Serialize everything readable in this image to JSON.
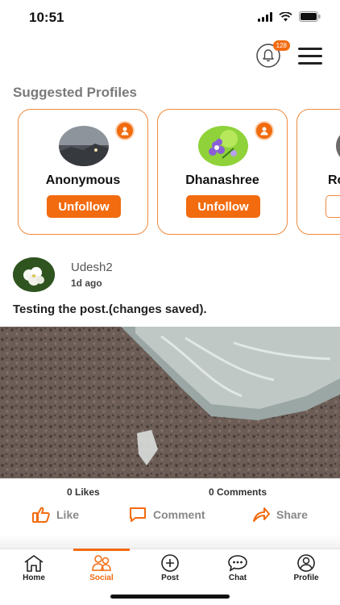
{
  "status_bar": {
    "time": "10:51"
  },
  "notifications": {
    "count": "128",
    "icon": "bell-icon"
  },
  "suggested": {
    "title": "Suggested Profiles",
    "profiles": [
      {
        "name": "Anonymous",
        "button_label": "Unfollow"
      },
      {
        "name": "Dhanashree",
        "button_label": "Unfollow"
      },
      {
        "name": "Ro",
        "button_label": ""
      }
    ]
  },
  "post": {
    "username": "Udesh2",
    "time": "1d ago",
    "text": "Testing the post.(changes saved).",
    "likes_count": "0 Likes",
    "comments_count": "0 Comments",
    "actions": {
      "like": "Like",
      "comment": "Comment",
      "share": "Share"
    }
  },
  "nav": {
    "items": [
      {
        "label": "Home",
        "icon": "home-icon"
      },
      {
        "label": "Social",
        "icon": "social-icon",
        "active": true
      },
      {
        "label": "Post",
        "icon": "plus-circle-icon"
      },
      {
        "label": "Chat",
        "icon": "chat-icon"
      },
      {
        "label": "Profile",
        "icon": "profile-icon"
      }
    ]
  },
  "colors": {
    "accent": "#f26b0f",
    "card_border": "#f08a3c",
    "muted_text": "#888888"
  }
}
